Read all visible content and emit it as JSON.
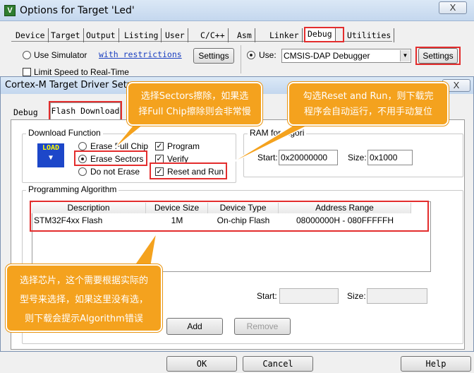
{
  "outer_window": {
    "title": "Options for Target 'Led'",
    "close_label": "X",
    "tabs": [
      "Device",
      "Target",
      "Output",
      "Listing",
      "User",
      "C/C++",
      "Asm",
      "Linker",
      "Debug",
      "Utilities"
    ],
    "use_simulator": "Use Simulator",
    "with_restrictions": "with restrictions",
    "settings_left": "Settings",
    "limit_speed": "Limit Speed to Real-Time",
    "use_label": "Use:",
    "debugger_value": "CMSIS-DAP Debugger",
    "settings_right": "Settings",
    "ok": "OK",
    "cancel": "Cancel",
    "help": "Help"
  },
  "inner_dialog": {
    "title": "Cortex-M Target Driver Setu",
    "close_label": "X",
    "tabs": [
      "Debug",
      "Flash Download"
    ],
    "download_function": {
      "label": "Download Function",
      "load_icon": "LOAD",
      "erase_full_chip": "Erase Full Chip",
      "erase_sectors": "Erase Sectors",
      "do_not_erase": "Do not Erase",
      "program": "Program",
      "verify": "Verify",
      "reset_and_run": "Reset and Run"
    },
    "ram": {
      "label": "RAM for Algori",
      "start_label": "Start:",
      "start_value": "0x20000000",
      "size_label": "Size:",
      "size_value": "0x1000"
    },
    "programming_algorithm": {
      "label": "Programming Algorithm",
      "columns": [
        "Description",
        "Device Size",
        "Device Type",
        "Address Range"
      ],
      "rows": [
        {
          "description": "STM32F4xx Flash",
          "size": "1M",
          "type": "On-chip Flash",
          "range": "08000000H - 080FFFFFH"
        }
      ],
      "start_label": "Start:",
      "size_label": "Size:",
      "add": "Add",
      "remove": "Remove"
    }
  },
  "callouts": {
    "sectors": [
      "选择Sectors擦除，如果选",
      "择Full Chip擦除则会非常慢"
    ],
    "reset": [
      "勾选Reset and Run，则下载完",
      "程序会自动运行，不用手动复位"
    ],
    "chip": [
      "选择芯片，这个需要根据实际的",
      "型号来选择，如果这里没有选，",
      "则下载会提示Algorithm错误"
    ]
  },
  "colors": {
    "accent_red": "#e32d2d",
    "callout_orange": "#f4a21e"
  }
}
